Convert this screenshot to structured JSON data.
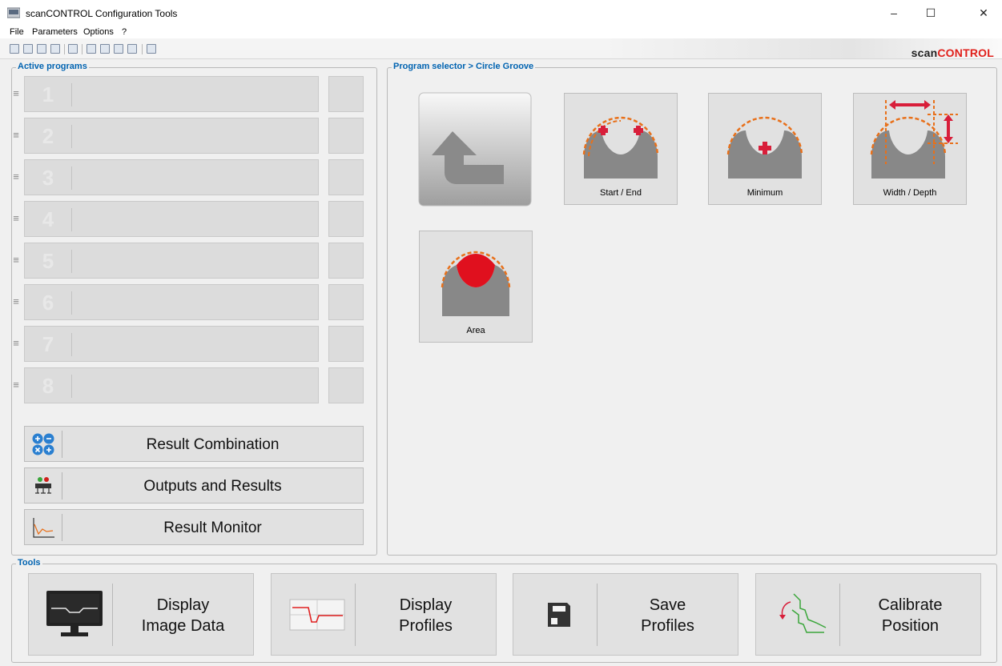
{
  "window": {
    "title": "scanCONTROL Configuration Tools",
    "minimize": "–",
    "maximize": "☐",
    "close": "✕"
  },
  "menu": [
    "File",
    "Parameters",
    "Options",
    "?"
  ],
  "brand": {
    "part1": "scan",
    "part2": "CONTROL"
  },
  "active_programs": {
    "label": "Active programs",
    "slots": [
      "1",
      "2",
      "3",
      "4",
      "5",
      "6",
      "7",
      "8"
    ],
    "buttons": {
      "result_combination": "Result Combination",
      "outputs_results": "Outputs and Results",
      "result_monitor": "Result Monitor"
    }
  },
  "program_selector": {
    "label": "Program selector > Circle Groove",
    "tiles": {
      "start_end": "Start / End",
      "minimum": "Minimum",
      "width_depth": "Width / Depth",
      "area": "Area"
    }
  },
  "tools": {
    "label": "Tools",
    "buttons": {
      "display_image_data": "Display\nImage Data",
      "display_profiles": "Display\nProfiles",
      "save_profiles": "Save\nProfiles",
      "calibrate_position": "Calibrate\nPosition"
    }
  },
  "colors": {
    "group_label": "#0063b1",
    "brand_red": "#e0201b",
    "accent_orange": "#e8701a",
    "accent_red": "#e0203a"
  }
}
